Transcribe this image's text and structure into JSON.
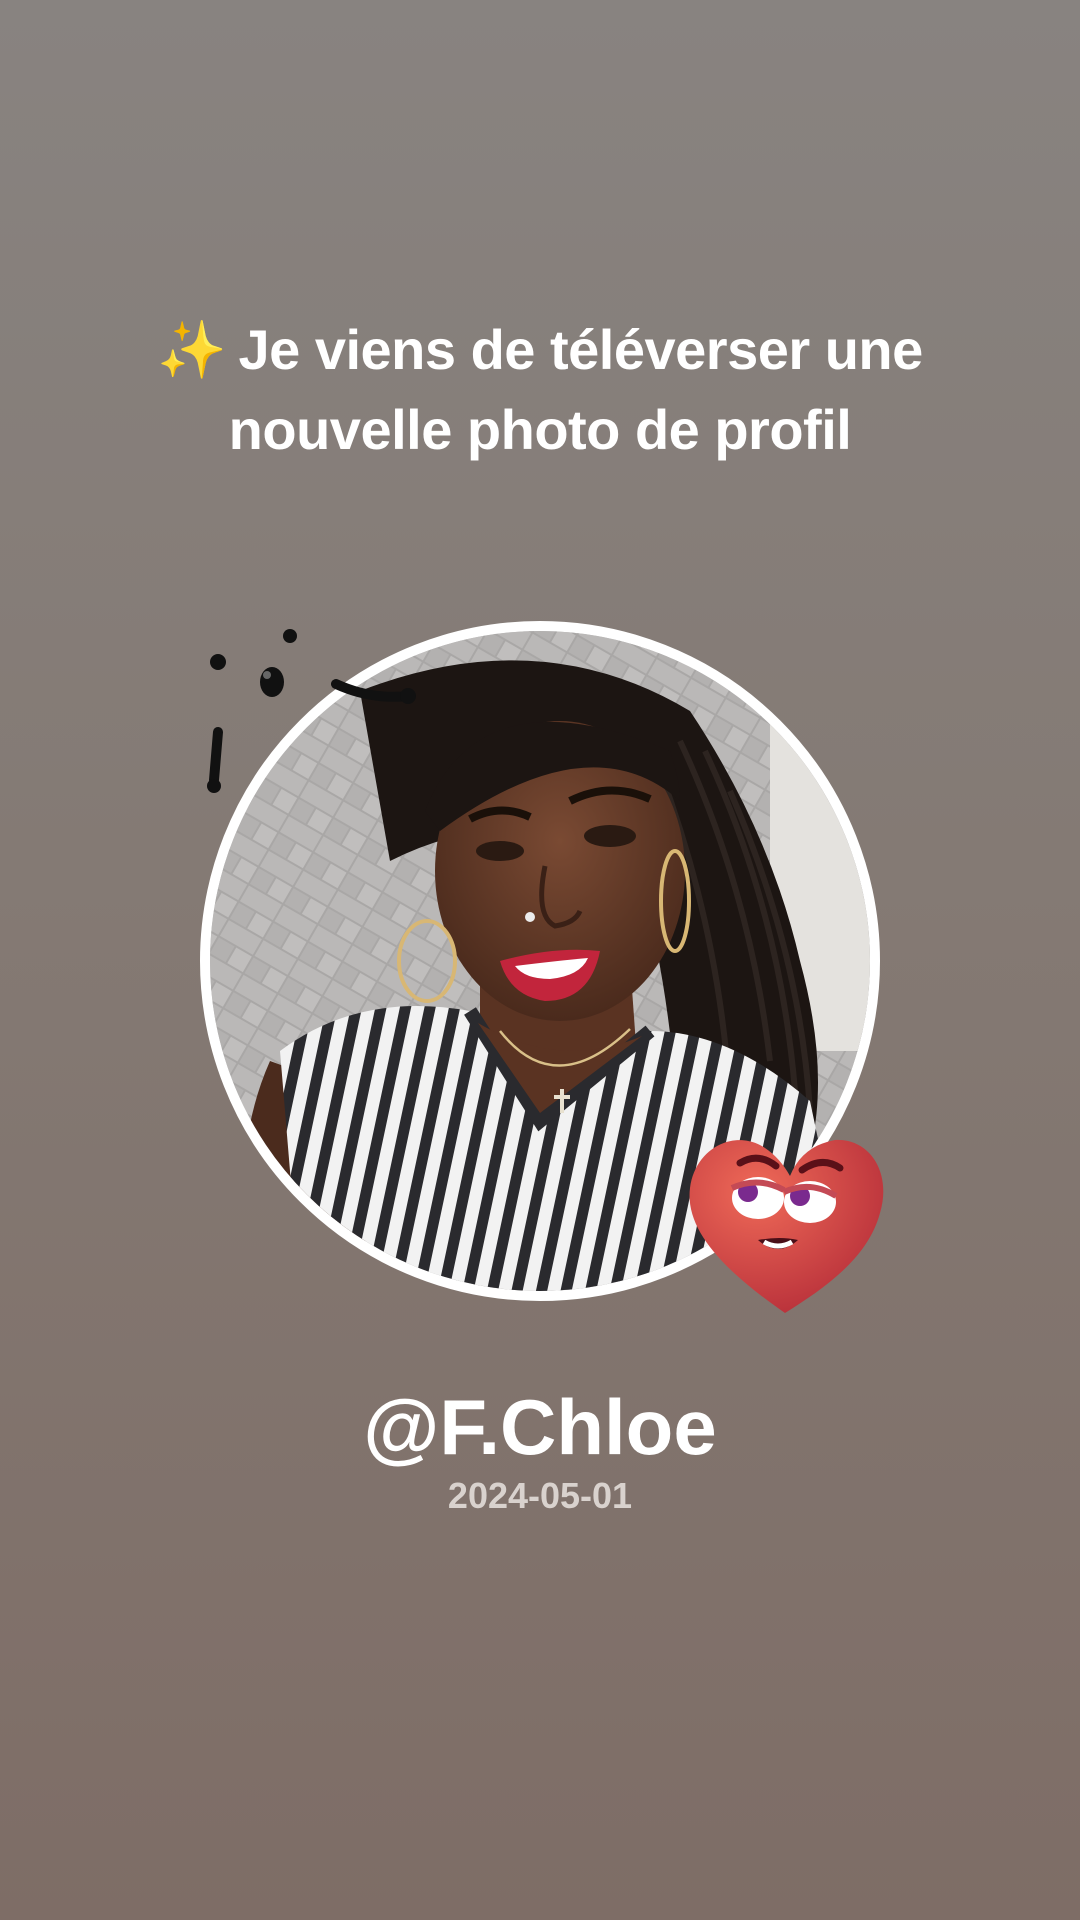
{
  "post": {
    "sparkle_icon": "✨",
    "headline": "Je viens de téléverser une nouvelle photo de profil",
    "username": "@F.Chloe",
    "date": "2024-05-01"
  },
  "stickers": {
    "doodle": "hand-drawn-doodle-marks",
    "heart": "winking-heart-face-sticker"
  },
  "colors": {
    "background_top": "#888380",
    "background_bottom": "#7e6d66",
    "avatar_ring": "#ffffff",
    "heart": "#d9453f"
  }
}
